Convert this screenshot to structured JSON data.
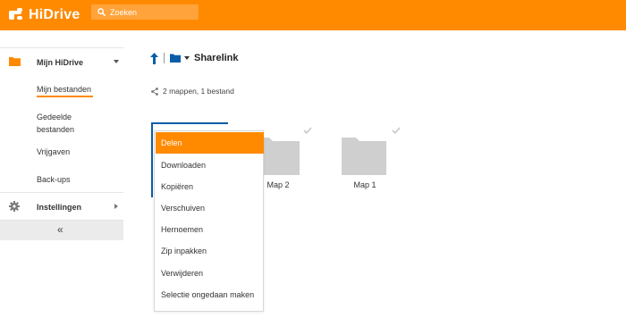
{
  "app": {
    "name": "HiDrive",
    "brand_color": "#ff8a00"
  },
  "search": {
    "placeholder": "Zoeken",
    "icon": "search-icon"
  },
  "sidebar": {
    "sections": [
      {
        "label": "Mijn HiDrive",
        "icon": "folder-icon",
        "expanded": true
      },
      {
        "label": "Instellingen",
        "icon": "gear-icon",
        "expanded": false
      }
    ],
    "items": [
      {
        "label": "Mijn bestanden",
        "active": true
      },
      {
        "label": "Gedeelde bestanden"
      },
      {
        "label": "Vrijgaven"
      },
      {
        "label": "Back-ups"
      }
    ],
    "collapse_label": "«"
  },
  "breadcrumb": {
    "up_icon": "up-arrow-icon",
    "folder_icon": "folder-icon",
    "title": "Sharelink"
  },
  "info": {
    "icon": "share-icon",
    "text": "2 mappen, 1 bestand"
  },
  "folders": [
    {
      "name": "Map 2"
    },
    {
      "name": "Map 1"
    }
  ],
  "context_menu": {
    "items": [
      {
        "label": "Delen",
        "active": true
      },
      {
        "label": "Downloaden"
      },
      {
        "label": "Kopiëren"
      },
      {
        "label": "Verschuiven"
      },
      {
        "label": "Hernoemen"
      },
      {
        "label": "Zip inpakken"
      },
      {
        "label": "Verwijderen"
      },
      {
        "label": "Selectie ongedaan maken"
      }
    ]
  }
}
